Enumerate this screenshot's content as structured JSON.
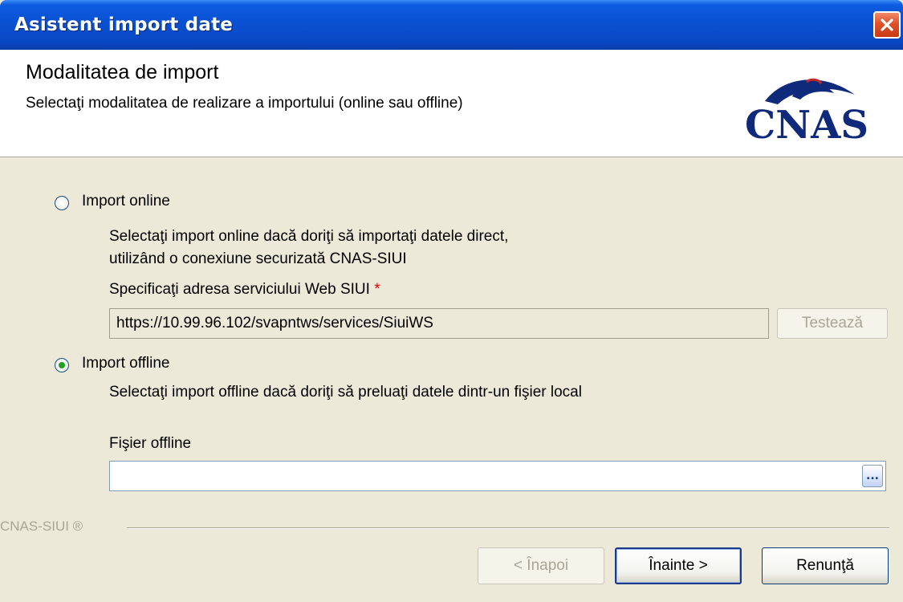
{
  "window": {
    "title": "Asistent import date",
    "close_label": "close"
  },
  "header": {
    "title": "Modalitatea de import",
    "subtitle": "Selectaţi modalitatea de realizare a importului (online sau offline)",
    "logo_text": "CNAS"
  },
  "online": {
    "label": "Import online",
    "selected": false,
    "description_line1": "Selectaţi import online dacă doriţi să importaţi datele direct,",
    "description_line2": " utilizând o conexiune securizată CNAS-SIUI",
    "url_label": "Specificaţi adresa serviciului Web SIUI",
    "required_mark": "*",
    "url_value": "https://10.99.96.102/svapntws/services/SiuiWS",
    "test_button": "Testează"
  },
  "offline": {
    "label": "Import offline",
    "selected": true,
    "description": "Selectaţi import offline dacă doriţi să preluaţi datele dintr-un fişier local",
    "file_label": "Fişier offline",
    "file_value": "",
    "browse_label": "..."
  },
  "footer": {
    "brand": "CNAS-SIUI ®",
    "back_button": "< Înapoi",
    "next_button": "Înainte >",
    "cancel_button": "Renunţă"
  },
  "colors": {
    "titlebar": "#0a4fd0",
    "dialog_bg": "#ece9d8",
    "radio_selected": "#21a121",
    "required": "#e00000",
    "logo": "#0f2a7a"
  },
  "icons": {
    "close": "close-icon",
    "logo": "cnas-logo"
  }
}
